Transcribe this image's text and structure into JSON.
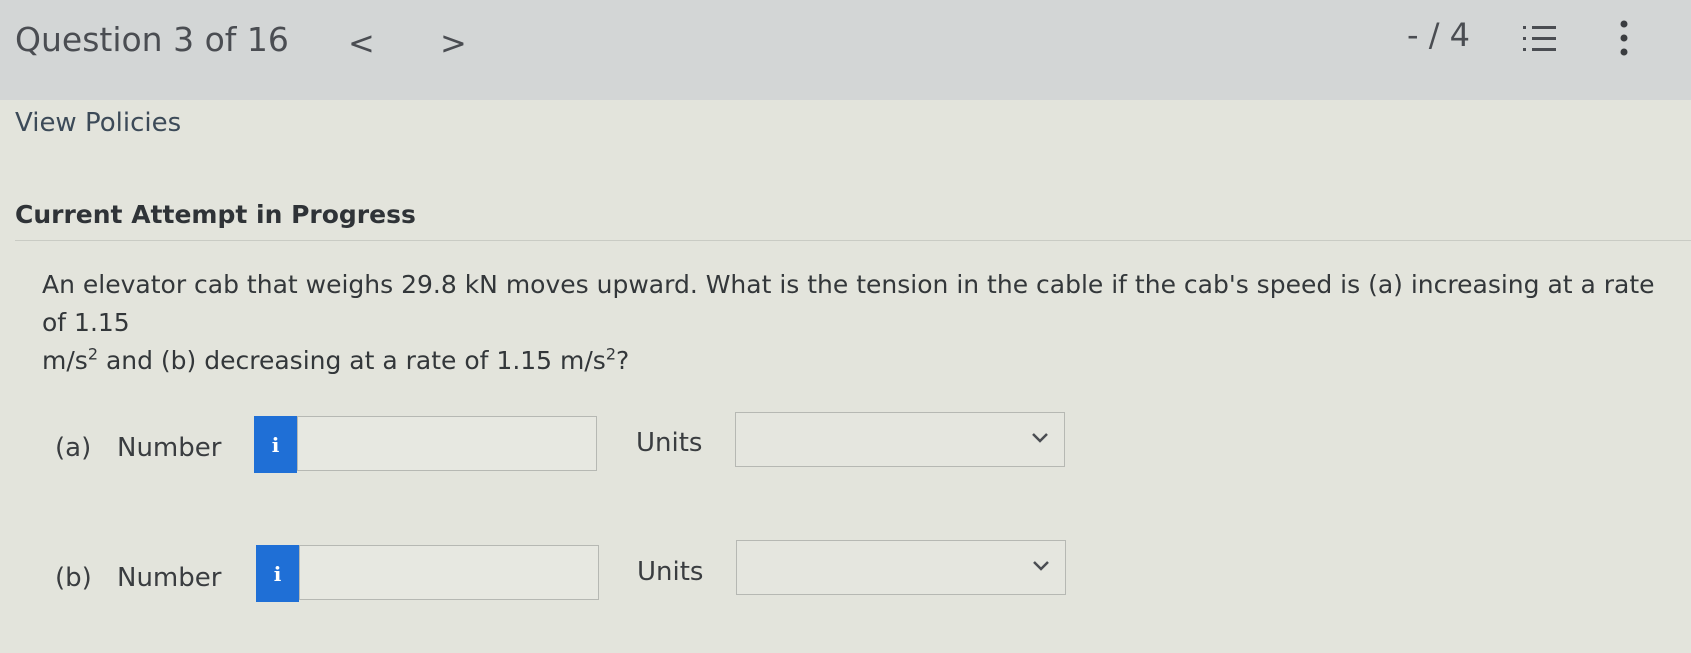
{
  "header": {
    "question_counter": "Question 3 of 16",
    "prev_label": "<",
    "next_label": ">",
    "score": "- / 4",
    "list_icon": "list-icon",
    "more_icon": "kebab-menu-icon"
  },
  "view_policies": "View Policies",
  "attempt_heading": "Current Attempt in Progress",
  "question": {
    "line1": "An elevator cab that weighs 29.8 kN moves upward. What is the tension in the cable if the cab's speed is (a) increasing at a rate of 1.15",
    "line2_a": "m/s",
    "sup1": "2",
    "line2_b": " and (b) decreasing at a rate of 1.15 m/s",
    "sup2": "2",
    "line2_c": "?"
  },
  "parts": [
    {
      "label": "(a)",
      "number_label": "Number",
      "info_icon": "i",
      "value": "",
      "units_label": "Units",
      "units_value": ""
    },
    {
      "label": "(b)",
      "number_label": "Number",
      "info_icon": "i",
      "value": "",
      "units_label": "Units",
      "units_value": ""
    }
  ],
  "colors": {
    "accent": "#1f6fd6",
    "background": "#e3e4dc",
    "header_bg": "#d3d6d6"
  }
}
